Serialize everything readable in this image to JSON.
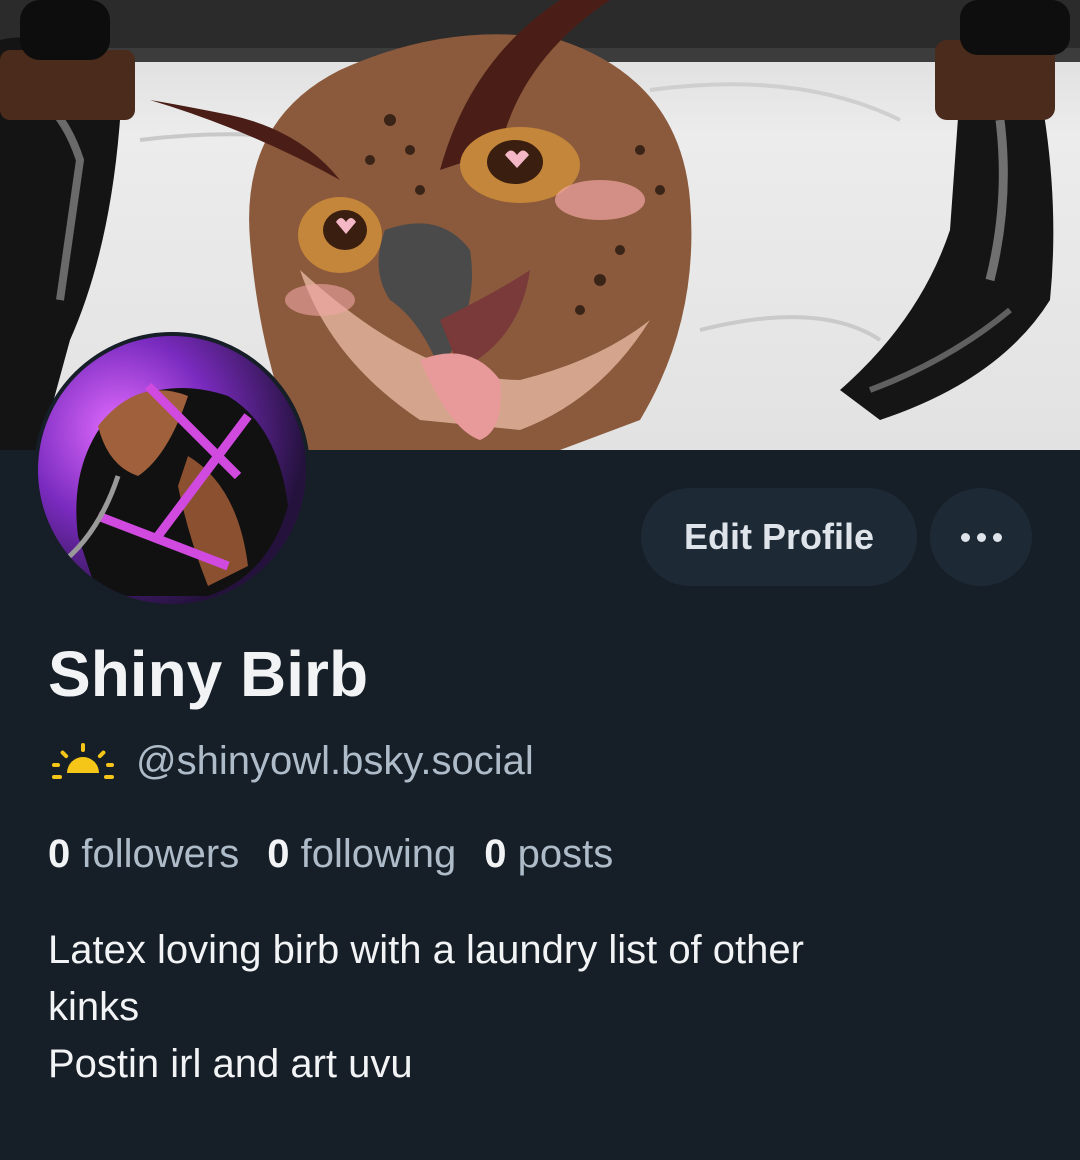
{
  "profile": {
    "display_name": "Shiny Birb",
    "handle": "@shinyowl.bsky.social",
    "handle_icon": "sunrise-icon",
    "stats": {
      "followers_count": "0",
      "followers_label": "followers",
      "following_count": "0",
      "following_label": "following",
      "posts_count": "0",
      "posts_label": "posts"
    },
    "bio_lines": [
      "Latex loving birb with a laundry list of other",
      "kinks",
      "Postin irl and art uvu"
    ]
  },
  "actions": {
    "edit_label": "Edit Profile",
    "more_icon": "more-dots-icon"
  },
  "colors": {
    "background": "#161e27",
    "button_bg": "#1e2936",
    "muted_text": "#aebbc9",
    "primary_text": "#f1f3f5",
    "handle_icon": "#f5c518"
  }
}
